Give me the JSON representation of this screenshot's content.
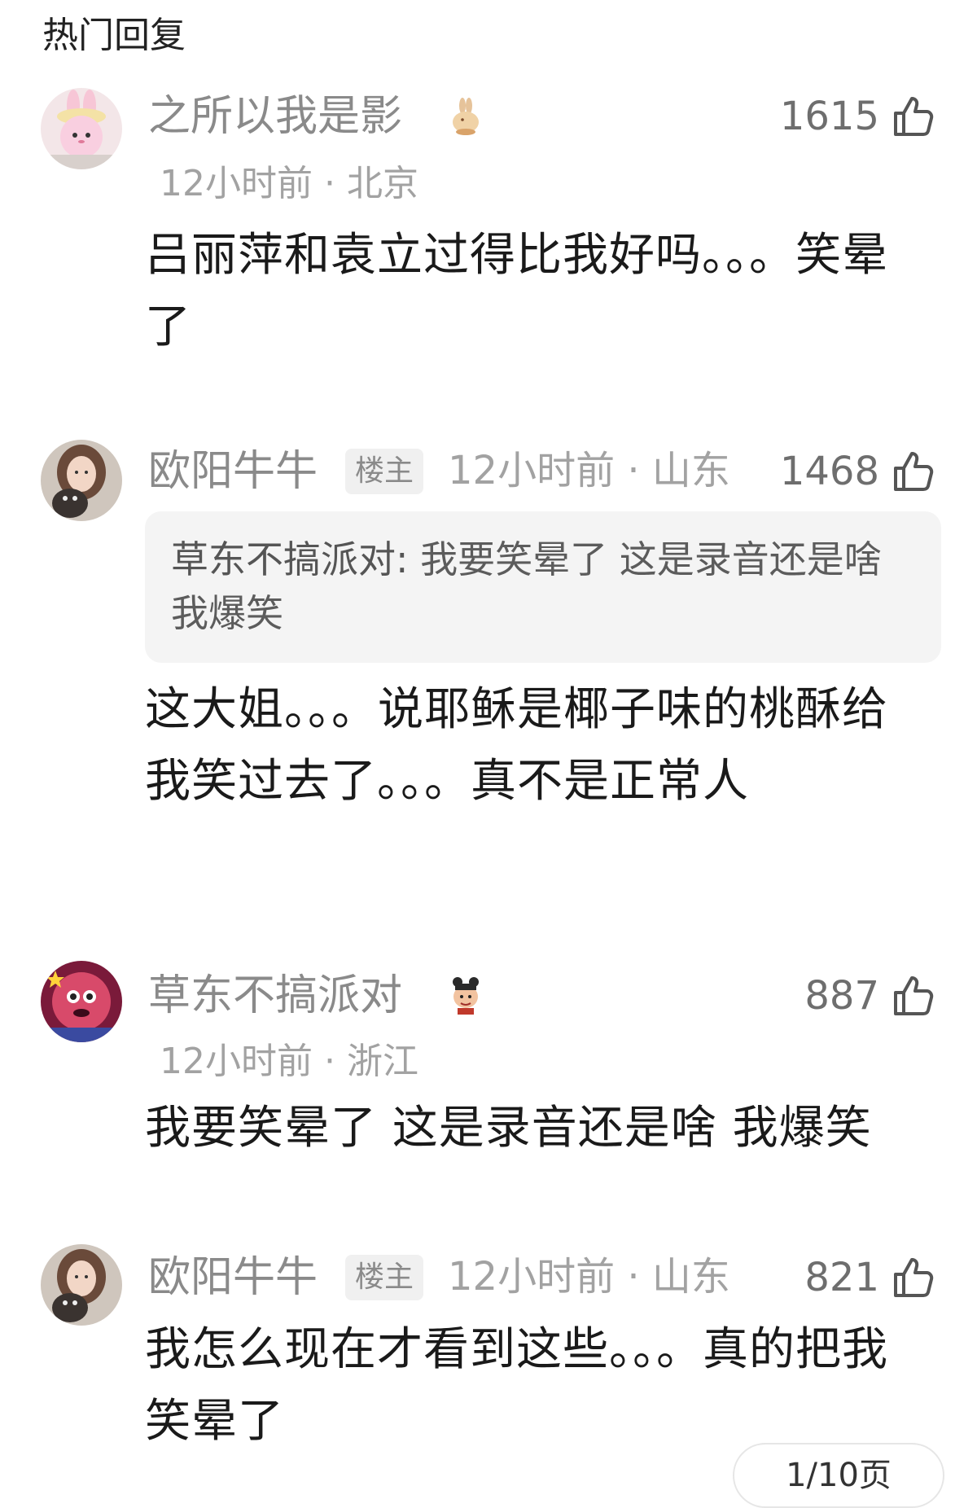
{
  "section_title": "热门回复",
  "comments": [
    {
      "username": "之所以我是影",
      "badge": "rabbit-badge",
      "time": "12小时前",
      "location": "北京",
      "likes": "1615",
      "text": "吕丽萍和袁立过得比我好吗。。。笑晕了"
    },
    {
      "username": "欧阳牛牛",
      "op_label": "楼主",
      "time": "12小时前",
      "location": "山东",
      "likes": "1468",
      "quote_name": "草东不搞派对:",
      "quote_text": "我要笑晕了 这是录音还是啥 我爆笑",
      "text": "这大姐。。。说耶稣是椰子味的桃酥给我笑过去了。。。真不是正常人"
    },
    {
      "username": "草东不搞派对",
      "badge": "nezha-badge",
      "time": "12小时前",
      "location": "浙江",
      "likes": "887",
      "text": "我要笑晕了 这是录音还是啥 我爆笑"
    },
    {
      "username": "欧阳牛牛",
      "op_label": "楼主",
      "time": "12小时前",
      "location": "山东",
      "likes": "821",
      "text": "我怎么现在才看到这些。。。真的把我笑晕了"
    }
  ],
  "pager": "1/10页",
  "colors": {
    "username": "#8a8a8a",
    "meta": "#a2a2a2",
    "body": "#1a1a1a",
    "quote_bg": "#f4f4f4"
  }
}
